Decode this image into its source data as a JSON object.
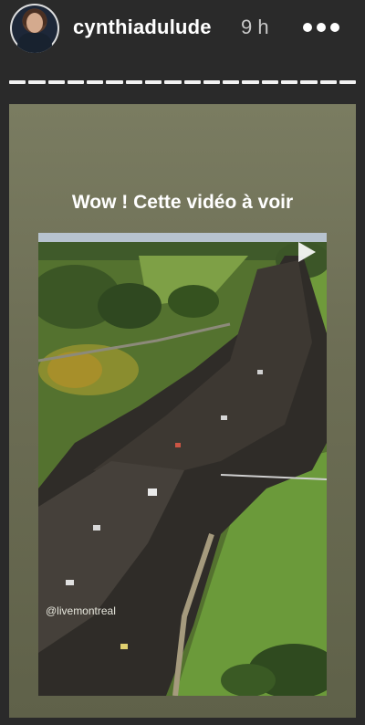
{
  "header": {
    "username": "cynthiadulude",
    "time": "9 h",
    "more_icon": "more-dots-icon"
  },
  "progress": {
    "segments": 18,
    "completed": 18
  },
  "story": {
    "caption": "Wow ! Cette vidéo à voir",
    "mention": "@livemontreal",
    "play_icon": "play-icon",
    "background": "#6f7056"
  }
}
